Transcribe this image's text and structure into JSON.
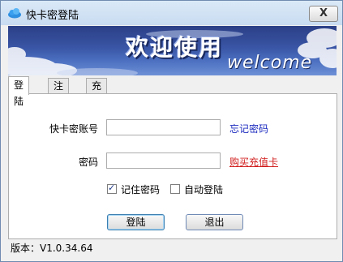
{
  "window": {
    "title": "快卡密登陆",
    "close_label": "X"
  },
  "banner": {
    "title": "欢迎使用",
    "subtitle": "welcome"
  },
  "tabs": [
    {
      "label": "登陆"
    },
    {
      "label": "注册"
    },
    {
      "label": "充值"
    }
  ],
  "form": {
    "account_label": "快卡密账号",
    "account_value": "",
    "forgot_link": "忘记密码",
    "password_label": "密码",
    "password_value": "",
    "buy_link": "购买充值卡",
    "remember_label": "记住密码",
    "remember_checked": true,
    "autologin_label": "自动登陆",
    "autologin_checked": false,
    "login_button": "登陆",
    "exit_button": "退出"
  },
  "status": {
    "version": "版本：V1.0.34.64"
  },
  "colors": {
    "link_blue": "#1c2bbf",
    "link_red": "#d11d1d",
    "banner_blue": "#3a56a6"
  }
}
